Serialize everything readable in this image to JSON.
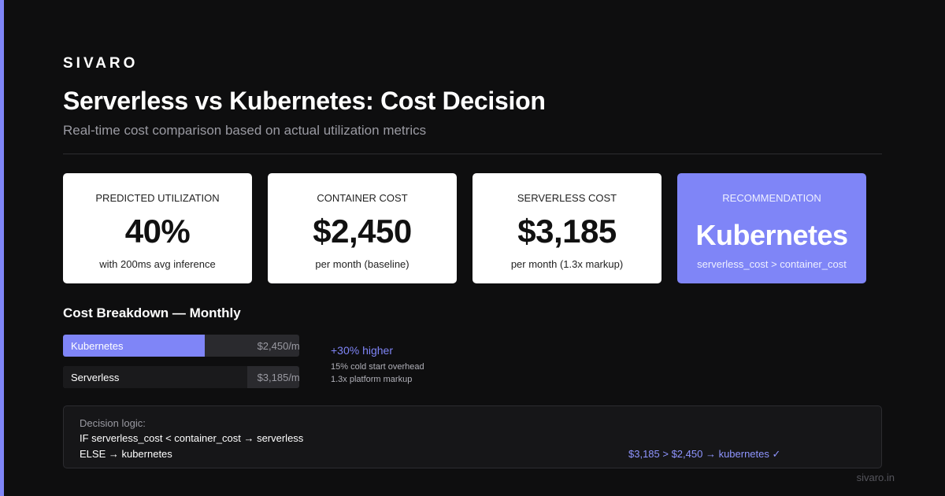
{
  "brand": "SIVARO",
  "title": "Serverless vs Kubernetes: Cost Decision",
  "subtitle": "Real-time cost comparison based on actual utilization metrics",
  "colors": {
    "accent": "#7f85f7",
    "background": "#0e0e0f",
    "card": "#ffffff"
  },
  "cards": [
    {
      "label": "PREDICTED UTILIZATION",
      "value": "40%",
      "sub": "with 200ms avg inference"
    },
    {
      "label": "CONTAINER COST",
      "value": "$2,450",
      "sub": "per month (baseline)"
    },
    {
      "label": "SERVERLESS COST",
      "value": "$3,185",
      "sub": "per month (1.3x markup)"
    },
    {
      "label": "RECOMMENDATION",
      "value": "Kubernetes",
      "sub": "serverless_cost > container_cost"
    }
  ],
  "breakdown": {
    "title": "Cost Breakdown — Monthly",
    "bars": [
      {
        "label": "Kubernetes",
        "amount": "$2,450/mo",
        "fill_fraction": 0.6
      },
      {
        "label": "Serverless",
        "amount": "$3,185/mo",
        "fill_fraction": 0.78
      }
    ],
    "delta": "+30% higher",
    "notes": [
      "15% cold start overhead",
      "1.3x platform markup"
    ]
  },
  "logic": {
    "heading": "Decision logic:",
    "line1": "IF serverless_cost < container_cost → serverless",
    "line2": "ELSE → kubernetes",
    "result": "$3,185 > $2,450 → kubernetes ✓"
  },
  "footer": "sivaro.in"
}
